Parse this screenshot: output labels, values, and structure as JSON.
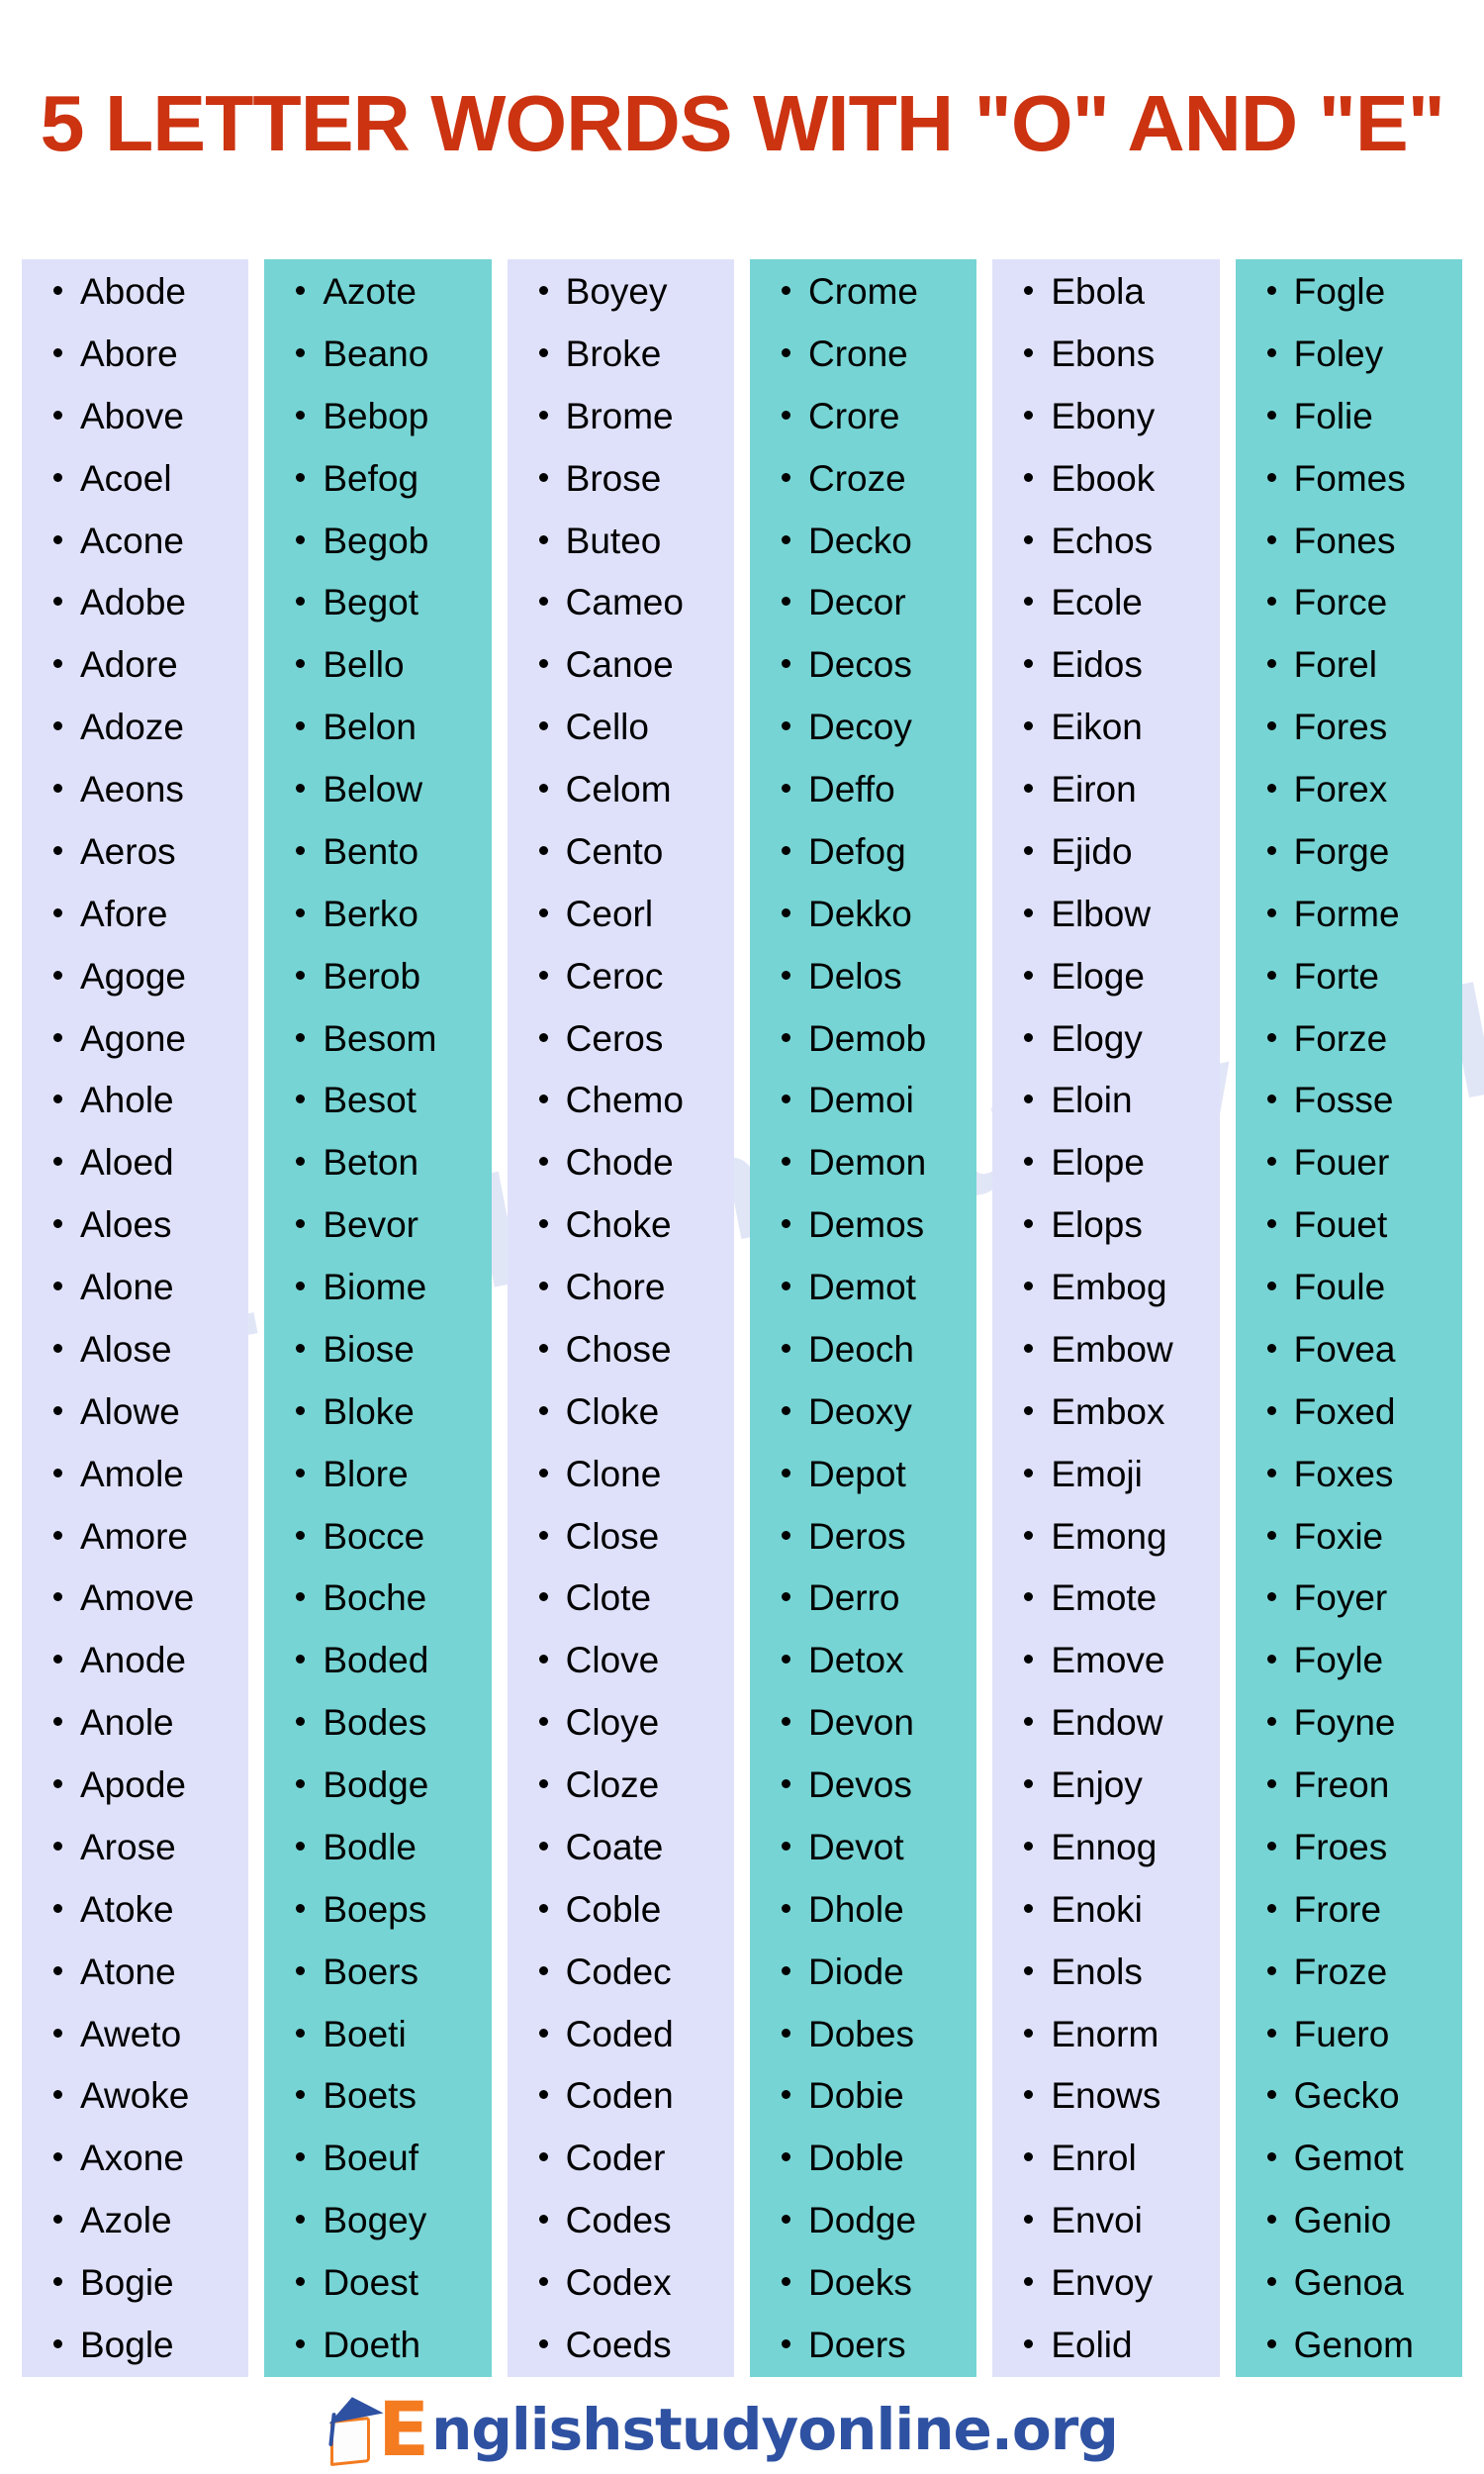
{
  "title": "5 LETTER WORDS WITH \"O\" AND \"E\"",
  "colors": {
    "title": "#cc3311",
    "column_lavender": "#dfe1fa",
    "column_teal": "#76d4d4",
    "text": "#000000",
    "logo_orange": "#f47b20",
    "logo_blue": "#2e51a2"
  },
  "watermark": "Englishstudyonline.org",
  "footer": {
    "logo_initial": "E",
    "logo_text": "nglishstudyonline.org"
  },
  "columns": [
    {
      "id": "column-1",
      "theme": "lavender",
      "words": [
        "Abode",
        "Abore",
        "Above",
        "Acoel",
        "Acone",
        "Adobe",
        "Adore",
        "Adoze",
        "Aeons",
        "Aeros",
        "Afore",
        "Agoge",
        "Agone",
        "Ahole",
        "Aloed",
        "Aloes",
        "Alone",
        "Alose",
        "Alowe",
        "Amole",
        "Amore",
        "Amove",
        "Anode",
        "Anole",
        "Apode",
        "Arose",
        "Atoke",
        "Atone",
        "Aweto",
        "Awoke",
        "Axone",
        "Azole",
        "Bogie",
        "Bogle"
      ]
    },
    {
      "id": "column-2",
      "theme": "teal",
      "words": [
        "Azote",
        "Beano",
        "Bebop",
        "Befog",
        "Begob",
        "Begot",
        "Bello",
        "Belon",
        "Below",
        "Bento",
        "Berko",
        "Berob",
        "Besom",
        "Besot",
        "Beton",
        "Bevor",
        "Biome",
        "Biose",
        "Bloke",
        "Blore",
        "Bocce",
        "Boche",
        "Boded",
        "Bodes",
        "Bodge",
        "Bodle",
        "Boeps",
        "Boers",
        "Boeti",
        "Boets",
        "Boeuf",
        "Bogey",
        "Doest",
        "Doeth"
      ]
    },
    {
      "id": "column-3",
      "theme": "lavender",
      "words": [
        "Boyey",
        "Broke",
        "Brome",
        "Brose",
        "Buteo",
        "Cameo",
        "Canoe",
        "Cello",
        "Celom",
        "Cento",
        "Ceorl",
        "Ceroc",
        "Ceros",
        "Chemo",
        "Chode",
        "Choke",
        "Chore",
        "Chose",
        "Cloke",
        "Clone",
        "Close",
        "Clote",
        "Clove",
        "Cloye",
        "Cloze",
        "Coate",
        "Coble",
        "Codec",
        "Coded",
        "Coden",
        "Coder",
        "Codes",
        "Codex",
        "Coeds"
      ]
    },
    {
      "id": "column-4",
      "theme": "teal",
      "words": [
        "Crome",
        "Crone",
        "Crore",
        "Croze",
        "Decko",
        "Decor",
        "Decos",
        "Decoy",
        "Deffo",
        "Defog",
        "Dekko",
        "Delos",
        "Demob",
        "Demoi",
        "Demon",
        "Demos",
        "Demot",
        "Deoch",
        "Deoxy",
        "Depot",
        "Deros",
        "Derro",
        "Detox",
        "Devon",
        "Devos",
        "Devot",
        "Dhole",
        "Diode",
        "Dobes",
        "Dobie",
        "Doble",
        "Dodge",
        "Doeks",
        "Doers"
      ]
    },
    {
      "id": "column-5",
      "theme": "lavender",
      "words": [
        "Ebola",
        "Ebons",
        "Ebony",
        "Ebook",
        "Echos",
        "Ecole",
        "Eidos",
        "Eikon",
        "Eiron",
        "Ejido",
        "Elbow",
        "Eloge",
        "Elogy",
        "Eloin",
        "Elope",
        "Elops",
        "Embog",
        "Embow",
        "Embox",
        "Emoji",
        "Emong",
        "Emote",
        "Emove",
        "Endow",
        "Enjoy",
        "Ennog",
        "Enoki",
        "Enols",
        "Enorm",
        "Enows",
        "Enrol",
        "Envoi",
        "Envoy",
        "Eolid"
      ]
    },
    {
      "id": "column-6",
      "theme": "teal",
      "words": [
        "Fogle",
        "Foley",
        "Folie",
        "Fomes",
        "Fones",
        "Force",
        "Forel",
        "Fores",
        "Forex",
        "Forge",
        "Forme",
        "Forte",
        "Forze",
        "Fosse",
        "Fouer",
        "Fouet",
        "Foule",
        "Fovea",
        "Foxed",
        "Foxes",
        "Foxie",
        "Foyer",
        "Foyle",
        "Foyne",
        "Freon",
        "Froes",
        "Frore",
        "Froze",
        "Fuero",
        "Gecko",
        "Gemot",
        "Genio",
        "Genoa",
        "Genom"
      ]
    }
  ]
}
